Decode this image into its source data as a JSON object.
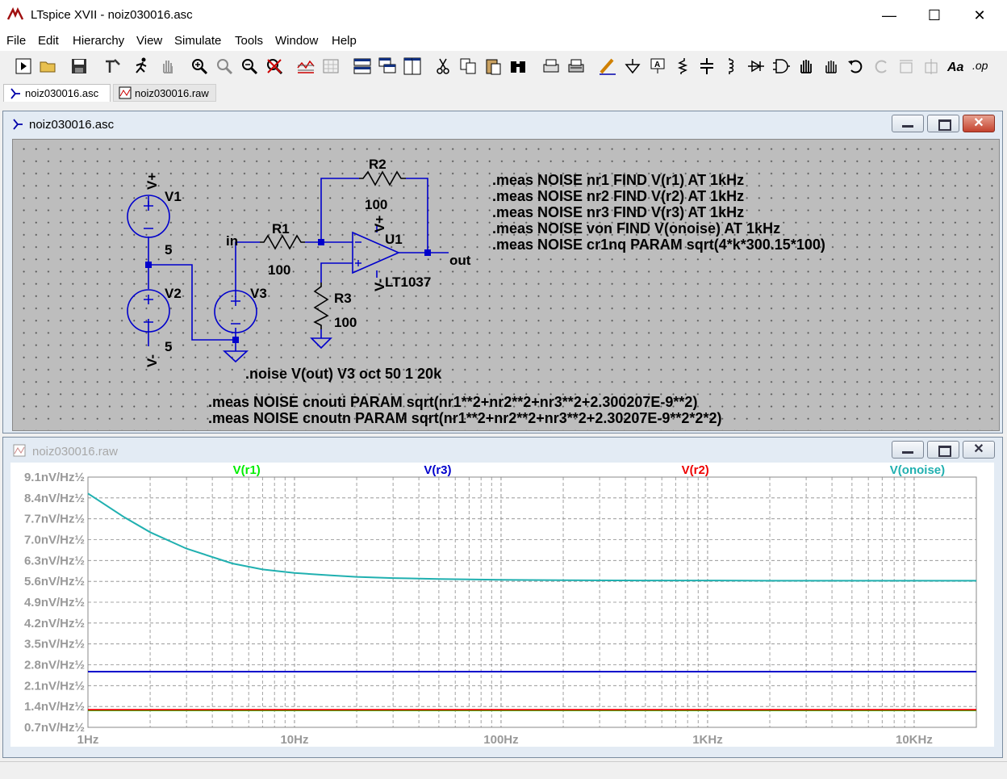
{
  "window": {
    "title": "LTspice XVII - noiz030016.asc"
  },
  "menu": [
    "File",
    "Edit",
    "Hierarchy",
    "View",
    "Simulate",
    "Tools",
    "Window",
    "Help"
  ],
  "tabs": [
    {
      "label": "noiz030016.asc",
      "active": true
    },
    {
      "label": "noiz030016.raw",
      "active": false
    }
  ],
  "schematic_window": {
    "title": "noiz030016.asc"
  },
  "schematic": {
    "components": {
      "v1": {
        "name": "V1",
        "value": "5",
        "pin_top": "V+"
      },
      "v2": {
        "name": "V2",
        "value": "5",
        "pin_bottom": "V-"
      },
      "v3": {
        "name": "V3"
      },
      "r1": {
        "name": "R1",
        "value": "100"
      },
      "r2": {
        "name": "R2",
        "value": "100"
      },
      "r3": {
        "name": "R3",
        "value": "100"
      },
      "u1": {
        "name": "U1",
        "model": "LT1037",
        "pin_top": "V+",
        "pin_bottom": "V-"
      }
    },
    "nets": {
      "in": "in",
      "out": "out"
    },
    "directives": [
      ".meas NOISE nr1 FIND V(r1) AT 1kHz",
      ".meas NOISE nr2 FIND V(r2) AT 1kHz",
      ".meas NOISE nr3 FIND V(r3) AT 1kHz",
      ".meas NOISE von FIND V(onoise) AT 1kHz",
      ".meas NOISE cr1nq PARAM sqrt(4*k*300.15*100)"
    ],
    "noise_directive": ".noise V(out) V3 oct 50 1 20k",
    "meas_bottom": [
      ".meas NOISE cnouti  PARAM sqrt(nr1**2+nr2**2+nr3**2+2.300207E-9**2)",
      ".meas NOISE cnoutn PARAM sqrt(nr1**2+nr2**2+nr3**2+2.30207E-9**2*2*2)"
    ]
  },
  "plot_window": {
    "title": "noiz030016.raw"
  },
  "chart_data": {
    "type": "line",
    "x_scale": "log",
    "xlim": [
      1,
      20000
    ],
    "ylim": [
      0.7,
      9.1
    ],
    "grid": true,
    "x_ticks": [
      {
        "value": 1,
        "label": "1Hz"
      },
      {
        "value": 10,
        "label": "10Hz"
      },
      {
        "value": 100,
        "label": "100Hz"
      },
      {
        "value": 1000,
        "label": "1KHz"
      },
      {
        "value": 10000,
        "label": "10KHz"
      }
    ],
    "y_ticks": [
      {
        "value": 0.7,
        "label": "0.7nV/Hz½"
      },
      {
        "value": 1.4,
        "label": "1.4nV/Hz½"
      },
      {
        "value": 2.1,
        "label": "2.1nV/Hz½"
      },
      {
        "value": 2.8,
        "label": "2.8nV/Hz½"
      },
      {
        "value": 3.5,
        "label": "3.5nV/Hz½"
      },
      {
        "value": 4.2,
        "label": "4.2nV/Hz½"
      },
      {
        "value": 4.9,
        "label": "4.9nV/Hz½"
      },
      {
        "value": 5.6,
        "label": "5.6nV/Hz½"
      },
      {
        "value": 6.3,
        "label": "6.3nV/Hz½"
      },
      {
        "value": 7.0,
        "label": "7.0nV/Hz½"
      },
      {
        "value": 7.7,
        "label": "7.7nV/Hz½"
      },
      {
        "value": 8.4,
        "label": "8.4nV/Hz½"
      },
      {
        "value": 9.1,
        "label": "9.1nV/Hz½"
      }
    ],
    "series": [
      {
        "name": "V(r1)",
        "color": "#00ee00",
        "x": [
          1,
          20000
        ],
        "y": [
          1.27,
          1.27
        ]
      },
      {
        "name": "V(r3)",
        "color": "#0000cc",
        "x": [
          1,
          20000
        ],
        "y": [
          2.57,
          2.57
        ]
      },
      {
        "name": "V(r2)",
        "color": "#ee0000",
        "x": [
          1,
          20000
        ],
        "y": [
          1.29,
          1.29
        ]
      },
      {
        "name": "V(onoise)",
        "color": "#20b0b0",
        "x": [
          1,
          1.5,
          2,
          3,
          5,
          7,
          10,
          15,
          20,
          30,
          50,
          100,
          200,
          500,
          1000,
          2000,
          5000,
          10000,
          20000
        ],
        "y": [
          8.55,
          7.75,
          7.25,
          6.7,
          6.2,
          6.0,
          5.88,
          5.8,
          5.75,
          5.71,
          5.68,
          5.65,
          5.64,
          5.63,
          5.63,
          5.62,
          5.62,
          5.62,
          5.62
        ]
      }
    ]
  }
}
